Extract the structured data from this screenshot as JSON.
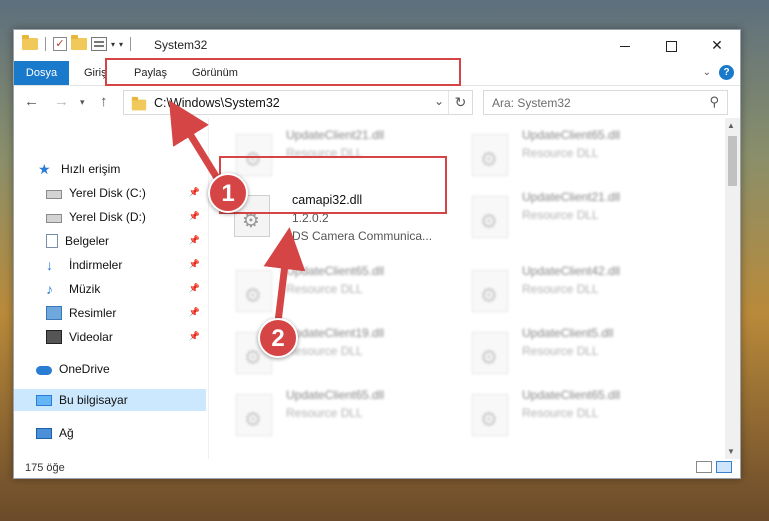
{
  "window": {
    "title": "System32",
    "controls": {
      "minimize": "",
      "maximize": "",
      "close": "✕"
    }
  },
  "ribbon": {
    "tabs": [
      "Dosya",
      "Giriş",
      "Paylaş",
      "Görünüm"
    ],
    "help": "?"
  },
  "nav": {
    "address": "C:\\Windows\\System32",
    "search_placeholder": "Ara: System32"
  },
  "sidebar": {
    "items": [
      {
        "label": "Hızlı erişim",
        "icon": "star-icon"
      },
      {
        "label": "Yerel Disk (C:)",
        "icon": "disk-icon",
        "pinned": true
      },
      {
        "label": "Yerel Disk (D:)",
        "icon": "disk-icon",
        "pinned": true
      },
      {
        "label": "Belgeler",
        "icon": "document-icon",
        "pinned": true
      },
      {
        "label": "İndirmeler",
        "icon": "download-icon",
        "pinned": true
      },
      {
        "label": "Müzik",
        "icon": "music-icon",
        "pinned": true
      },
      {
        "label": "Resimler",
        "icon": "picture-icon",
        "pinned": true
      },
      {
        "label": "Videolar",
        "icon": "video-icon",
        "pinned": true
      },
      {
        "label": "OneDrive",
        "icon": "cloud-icon"
      },
      {
        "label": "Bu bilgisayar",
        "icon": "computer-icon",
        "selected": true
      },
      {
        "label": "Ağ",
        "icon": "network-icon"
      }
    ]
  },
  "files": {
    "focused": {
      "name": "camapi32.dll",
      "version": "1.2.0.2",
      "description": "DS Camera Communica..."
    },
    "others": [
      {
        "name": "UpdateClient21.dll",
        "type": "Resource DLL"
      },
      {
        "name": "UpdateClient65.dll",
        "type": "Resource DLL"
      },
      {
        "name": "UpdateClient21.dll",
        "type": "Resource DLL"
      },
      {
        "name": "UpdateClient65.dll",
        "type": "Resource DLL"
      },
      {
        "name": "UpdateClient42.dll",
        "type": "Resource DLL"
      },
      {
        "name": "UpdateClient19.dll",
        "type": "Resource DLL"
      },
      {
        "name": "UpdateClient5.dll",
        "type": "Resource DLL"
      },
      {
        "name": "UpdateClient65.dll",
        "type": "Resource DLL"
      },
      {
        "name": "UpdateClient65.dll",
        "type": "Resource DLL"
      }
    ]
  },
  "status": {
    "item_count": "175 öğe"
  },
  "annotations": {
    "step1": "1",
    "step2": "2",
    "color": "#d64545"
  }
}
